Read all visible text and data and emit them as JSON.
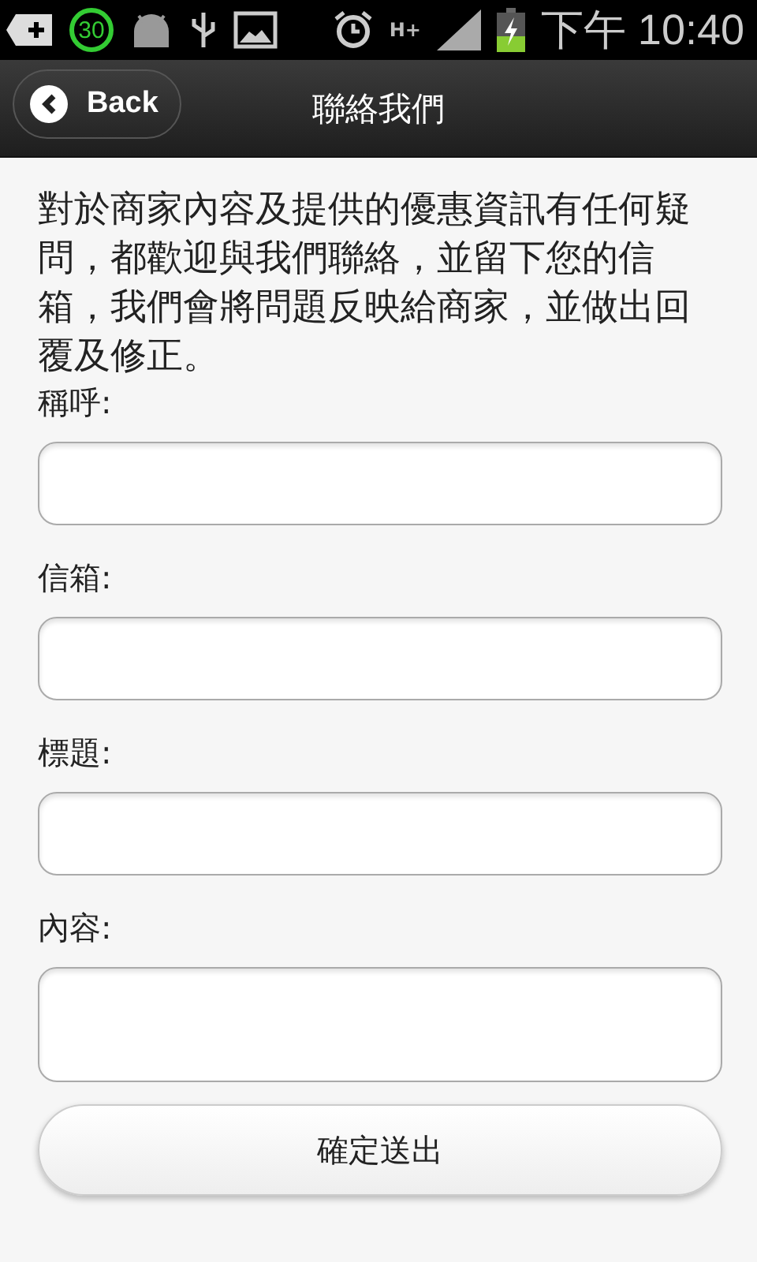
{
  "status_bar": {
    "badge": "30",
    "network": "H+",
    "time": "下午 10:40"
  },
  "header": {
    "back_button": "Back",
    "title": "聯絡我們"
  },
  "intro": "對於商家內容及提供的優惠資訊有任何疑問，都歡迎與我們聯絡，並留下您的信箱，我們會將問題反映給商家，並做出回覆及修正。",
  "fields": [
    {
      "label": "稱呼:",
      "kind": "input"
    },
    {
      "label": "信箱:",
      "kind": "input"
    },
    {
      "label": "標題:",
      "kind": "input"
    },
    {
      "label": "內容:",
      "kind": "textarea"
    }
  ],
  "submit_button": "確定送出"
}
